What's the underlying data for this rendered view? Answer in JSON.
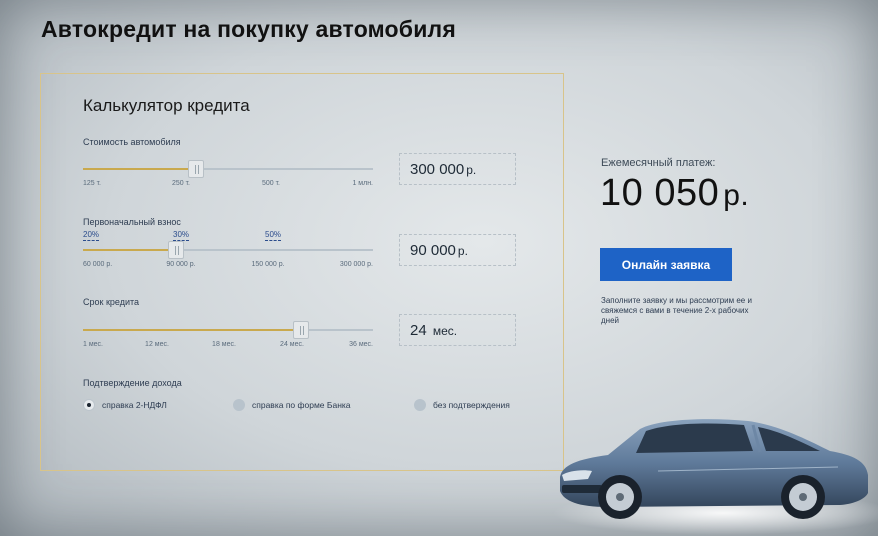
{
  "page": {
    "title": "Автокредит на покупку автомобиля"
  },
  "calculator": {
    "title": "Калькулятор кредита",
    "car_price": {
      "label": "Стоимость автомобиля",
      "value": "300 000",
      "unit": "р.",
      "slider_fraction": 0.39,
      "ticks": [
        "125 т.",
        "250 т.",
        "500 т.",
        "1 млн."
      ]
    },
    "down_payment": {
      "label": "Первоначальный взнос",
      "value": "90 000",
      "unit": "р.",
      "slider_fraction": 0.32,
      "presets": [
        "20%",
        "30%",
        "50%"
      ],
      "ticks": [
        "60 000 р.",
        "90 000 р.",
        "150 000 р.",
        "300 000 р."
      ]
    },
    "term": {
      "label": "Срок кредита",
      "value": "24",
      "unit": "мес.",
      "slider_fraction": 0.75,
      "ticks": [
        "1 мес.",
        "12 мес.",
        "18 мес.",
        "24 мес.",
        "36 мес."
      ]
    },
    "income": {
      "label": "Подтверждение дохода",
      "options": [
        "справка 2-НДФЛ",
        "справка по форме Банка",
        "без подтверждения"
      ],
      "selected": "справка 2-НДФЛ"
    }
  },
  "summary": {
    "monthly_label": "Ежемесячный платеж:",
    "monthly_amount": "10 050",
    "currency": "р.",
    "apply_button": "Онлайн заявка",
    "note": "Заполните заявку и мы рассмотрим ее и свяжемся с вами в течение 2-х рабочих дней"
  },
  "colors": {
    "accent": "#1e63c6",
    "slider_fill": "#c9a94e",
    "frame": "#d8c48a",
    "car_body": "#5f7a9a"
  }
}
